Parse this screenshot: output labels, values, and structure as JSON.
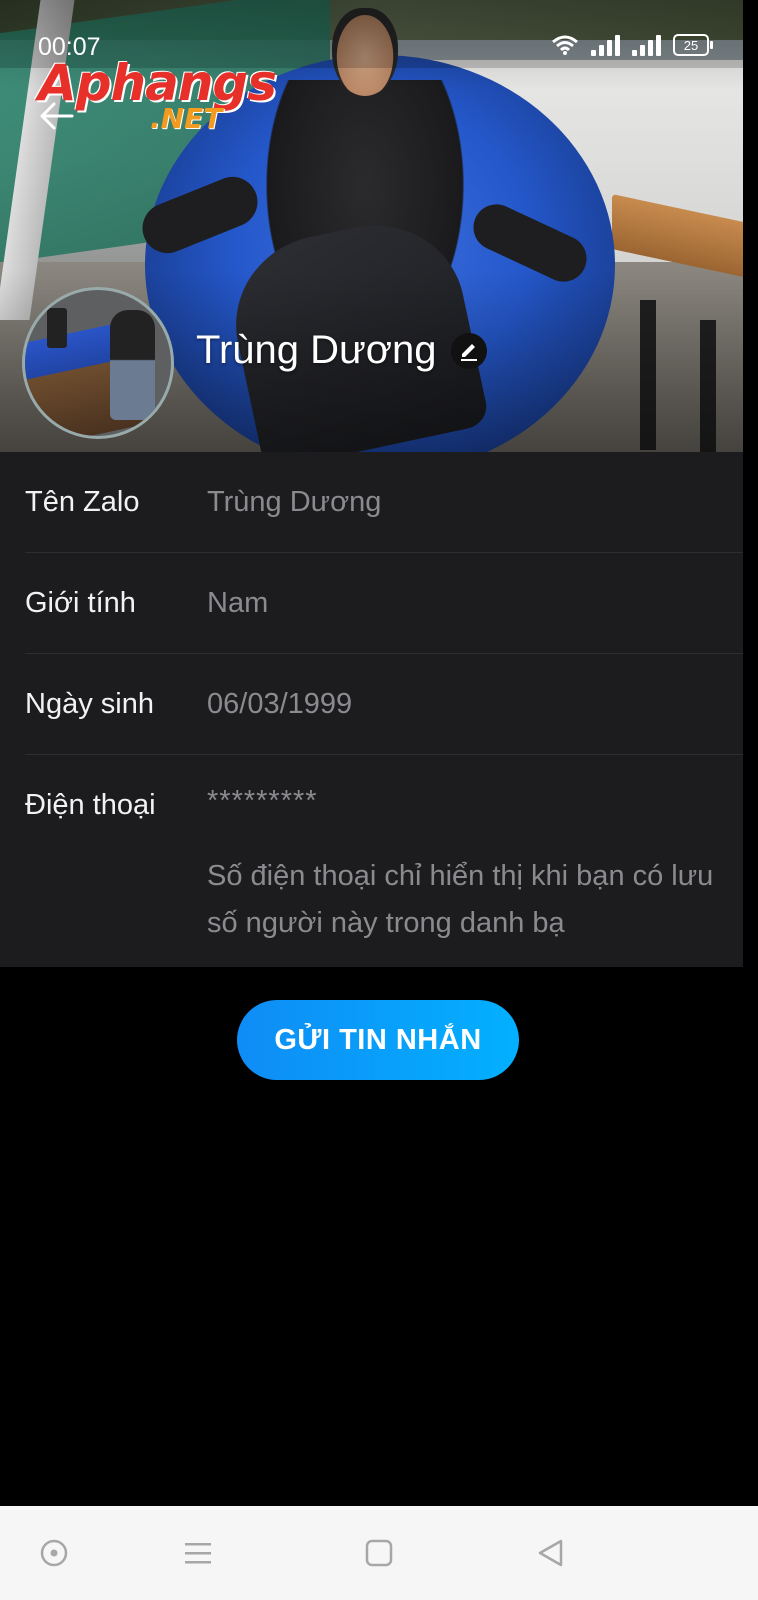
{
  "status_bar": {
    "time": "00:07",
    "battery": "25"
  },
  "watermark": {
    "top": "Aphangs",
    "bottom": ".NET"
  },
  "profile": {
    "display_name": "Trùng Dương"
  },
  "info_rows": [
    {
      "label": "Tên Zalo",
      "value": "Trùng Dương"
    },
    {
      "label": "Giới tính",
      "value": "Nam"
    },
    {
      "label": "Ngày sinh",
      "value": "06/03/1999"
    },
    {
      "label": "Điện thoại",
      "value": "*********"
    }
  ],
  "phone_hint": "Số điện thoại chỉ hiển thị khi bạn có lưu số người này trong danh bạ",
  "actions": {
    "send_message": "GỬI TIN NHẮN"
  },
  "icons": {
    "back": "back-arrow-icon",
    "edit": "pencil-icon",
    "wifi": "wifi-icon",
    "signal": "signal-icon",
    "battery": "battery-icon",
    "nav": [
      "assistant-icon",
      "menu-icon",
      "home-icon",
      "back-icon"
    ]
  },
  "colors": {
    "accent": "#0f8cf5",
    "panel": "#1c1c1e",
    "value_text": "#8b8b8f"
  }
}
